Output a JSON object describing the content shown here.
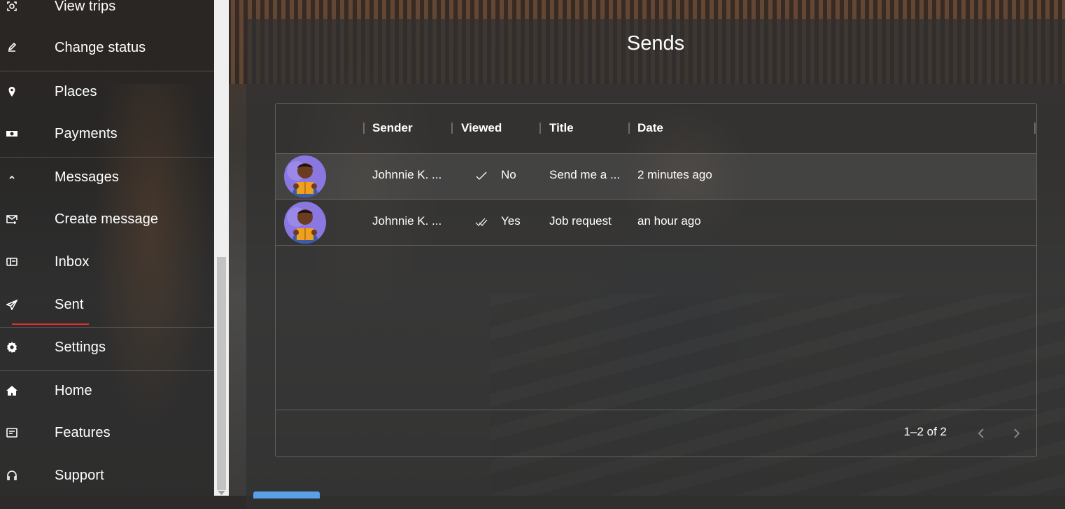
{
  "sidebar": {
    "items": [
      {
        "label": "View trips",
        "icon": "view-trips-icon"
      },
      {
        "label": "Change status",
        "icon": "edit-icon"
      },
      {
        "label": "Places",
        "icon": "location-pin-icon"
      },
      {
        "label": "Payments",
        "icon": "money-icon"
      },
      {
        "label": "Messages",
        "icon": "chevron-up-icon"
      },
      {
        "label": "Create message",
        "icon": "mail-add-icon"
      },
      {
        "label": "Inbox",
        "icon": "inbox-icon"
      },
      {
        "label": "Sent",
        "icon": "send-icon"
      },
      {
        "label": "Settings",
        "icon": "gear-icon"
      },
      {
        "label": "Home",
        "icon": "home-icon"
      },
      {
        "label": "Features",
        "icon": "features-icon"
      },
      {
        "label": "Support",
        "icon": "headset-icon"
      }
    ],
    "active": "Sent",
    "accent_color": "#e0302a"
  },
  "main": {
    "title": "Sends",
    "columns": [
      "Sender",
      "Viewed",
      "Title",
      "Date"
    ],
    "rows": [
      {
        "sender": "Johnnie K. ...",
        "viewed": "No",
        "viewed_icon": "single-check-icon",
        "title": "Send me a ...",
        "date": "2 minutes ago"
      },
      {
        "sender": "Johnnie K. ...",
        "viewed": "Yes",
        "viewed_icon": "double-check-icon",
        "title": "Job request",
        "date": "an hour ago"
      }
    ],
    "pagination": "1–2 of 2"
  }
}
